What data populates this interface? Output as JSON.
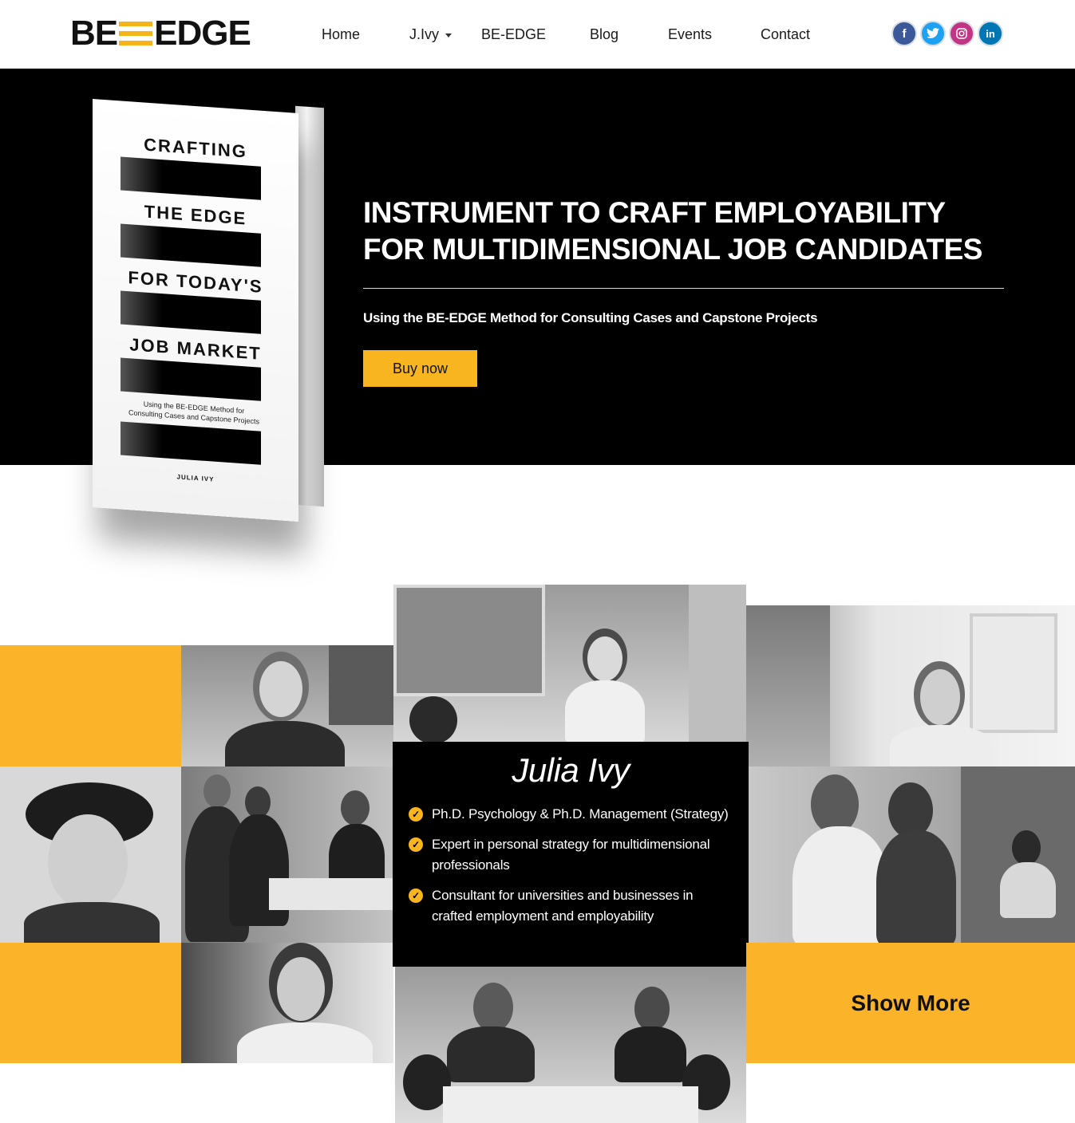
{
  "header": {
    "logo": {
      "left": "BE",
      "right": "EDGE"
    },
    "nav": [
      {
        "label": "Home"
      },
      {
        "label": "J.Ivy",
        "has_dropdown": true
      },
      {
        "label": "BE-EDGE"
      },
      {
        "label": "Blog"
      },
      {
        "label": "Events"
      },
      {
        "label": "Contact"
      }
    ],
    "social": [
      {
        "name": "facebook-icon",
        "glyph": "f",
        "color": "#3B5998"
      },
      {
        "name": "twitter-icon",
        "glyph": "t",
        "color": "#1DA1F2"
      },
      {
        "name": "instagram-icon",
        "glyph": "◎",
        "color": "#C13584"
      },
      {
        "name": "linkedin-icon",
        "glyph": "in",
        "color": "#0077B5"
      }
    ]
  },
  "hero": {
    "book": {
      "words": [
        "CRAFTING",
        "THE EDGE",
        "FOR TODAY'S",
        "JOB MARKET"
      ],
      "subtitle": "Using the BE-EDGE Method for Consulting Cases and Capstone Projects",
      "author": "JULIA IVY"
    },
    "title_line1": "INSTRUMENT TO CRAFT EMPLOYABILITY",
    "title_line2": "FOR MULTIDIMENSIONAL JOB CANDIDATES",
    "subtitle": "Using the BE-EDGE Method for Consulting Cases and Capstone Projects",
    "button": "Buy now"
  },
  "bio": {
    "name": "Julia Ivy",
    "items": [
      "Ph.D. Psychology & Ph.D. Management (Strategy)",
      "Expert in personal strategy for multidimensional professionals",
      "Consultant for universities and businesses in crafted employment and employability"
    ]
  },
  "gallery": {
    "show_more": "Show More"
  },
  "colors": {
    "accent": "#FBB429",
    "hero_bg": "#000000"
  }
}
